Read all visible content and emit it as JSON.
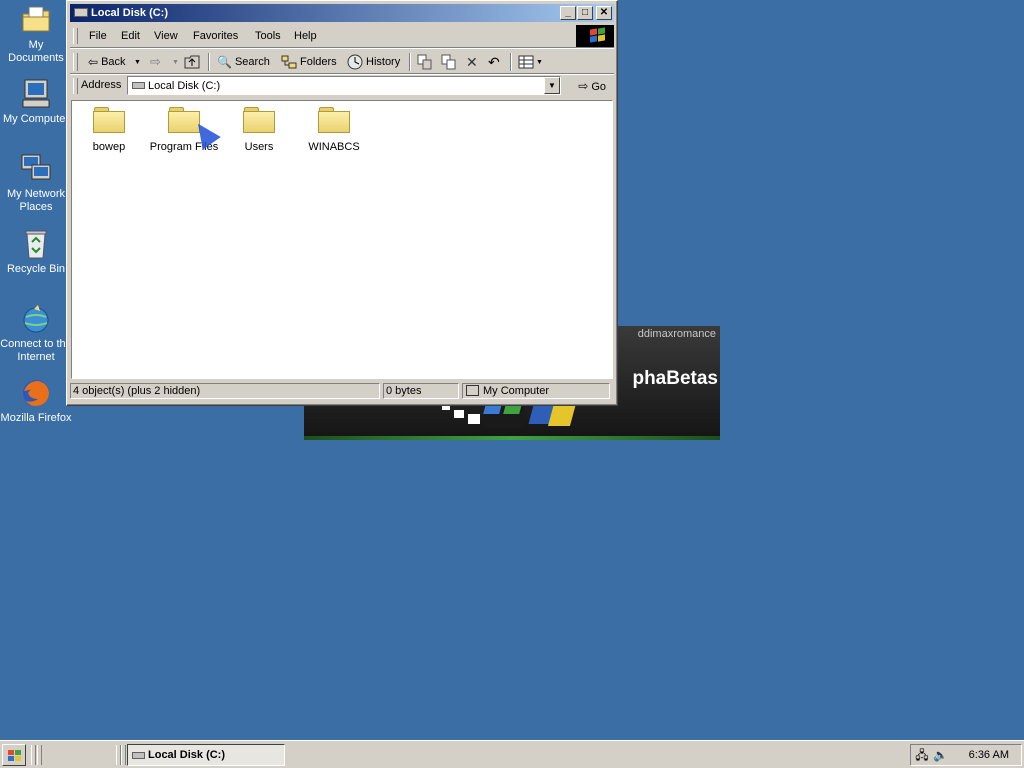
{
  "desktop": {
    "icons": [
      {
        "label": "My Documents",
        "icon": "my-documents-icon"
      },
      {
        "label": "My Computer",
        "icon": "my-computer-icon"
      },
      {
        "label": "My Network Places",
        "icon": "network-places-icon"
      },
      {
        "label": "Recycle Bin",
        "icon": "recycle-bin-icon"
      },
      {
        "label": "Connect to the Internet",
        "icon": "connect-internet-icon"
      },
      {
        "label": "Mozilla Firefox",
        "icon": "firefox-icon"
      }
    ]
  },
  "splash": {
    "username": "ddimaxromance",
    "brand_text": "phaBetas"
  },
  "window": {
    "title": "Local Disk (C:)",
    "menu": [
      "File",
      "Edit",
      "View",
      "Favorites",
      "Tools",
      "Help"
    ],
    "toolbar": {
      "back": "Back",
      "search": "Search",
      "folders": "Folders",
      "history": "History"
    },
    "address": {
      "label": "Address",
      "value": "Local Disk (C:)",
      "go": "Go"
    },
    "folders": [
      {
        "name": "bowep"
      },
      {
        "name": "Program Files"
      },
      {
        "name": "Users"
      },
      {
        "name": "WINABCS"
      }
    ],
    "status": {
      "objects": "4 object(s) (plus 2 hidden)",
      "size": "0 bytes",
      "zone": "My Computer"
    }
  },
  "taskbar": {
    "task": "Local Disk (C:)",
    "clock": "6:36 AM"
  },
  "colors": {
    "desktop": "#3a6ea5",
    "titlebar_start": "#0a246a",
    "titlebar_end": "#a6caf0",
    "chrome": "#d4d0c8"
  }
}
